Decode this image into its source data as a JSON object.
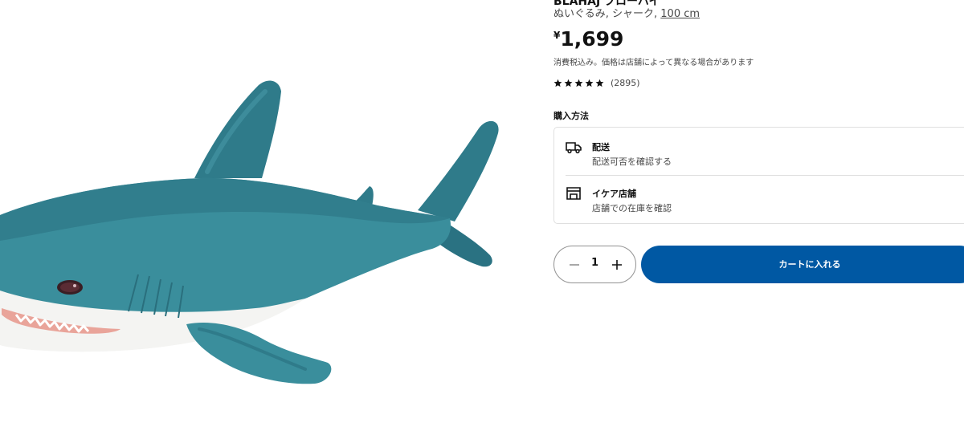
{
  "product": {
    "name": "BLÅHAJ ブローハイ",
    "description_prefix": "ぬいぐるみ, シャーク, ",
    "size": "100 cm",
    "price_currency": "¥",
    "price_amount": "1,699",
    "tax_note": "消費税込み。価格は店舗によって異なる場合があります",
    "rating_value": 5,
    "rating_count": "(2895)",
    "image_icon": "shark-plush-image"
  },
  "purchase": {
    "label": "購入方法",
    "options": [
      {
        "title": "配送",
        "subtitle": "配送可否を確認する",
        "icon": "truck-icon"
      },
      {
        "title": "イケア店舗",
        "subtitle": "店舗での在庫を確認",
        "icon": "store-icon"
      }
    ]
  },
  "cart": {
    "quantity": "1",
    "add_label": "カートに入れる"
  },
  "colors": {
    "accent": "#0058a3",
    "text": "#111111",
    "muted": "#484848",
    "border": "#dfdfdf"
  }
}
